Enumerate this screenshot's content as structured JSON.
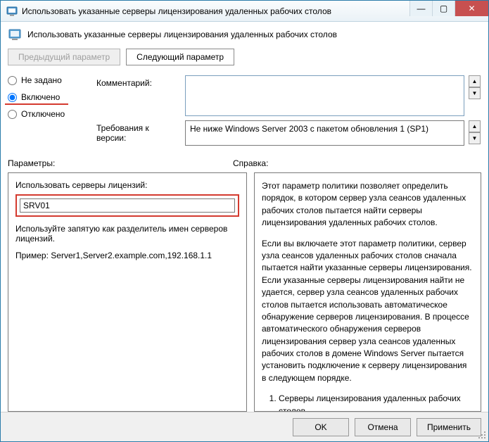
{
  "titlebar": {
    "title": "Использовать указанные серверы лицензирования удаленных рабочих столов"
  },
  "header": {
    "title": "Использовать указанные серверы лицензирования удаленных рабочих столов"
  },
  "nav": {
    "prev": "Предыдущий параметр",
    "next": "Следующий параметр"
  },
  "state": {
    "not_configured": "Не задано",
    "enabled": "Включено",
    "disabled": "Отключено",
    "selected": "enabled"
  },
  "fields": {
    "comment_label": "Комментарий:",
    "comment_value": "",
    "requirements_label": "Требования к версии:",
    "requirements_value": "Не ниже Windows Server 2003 с пакетом обновления 1 (SP1)"
  },
  "sections": {
    "options_label": "Параметры:",
    "help_label": "Справка:"
  },
  "options": {
    "servers_label": "Использовать серверы лицензий:",
    "servers_value": "SRV01",
    "hint": "Используйте запятую как разделитель имен серверов лицензий.",
    "example": "Пример: Server1,Server2.example.com,192.168.1.1"
  },
  "help": {
    "p1": "Этот параметр политики позволяет определить порядок, в котором сервер узла сеансов удаленных рабочих столов пытается найти серверы лицензирования удаленных рабочих столов.",
    "p2": "Если вы включаете этот параметр политики, сервер узла сеансов удаленных рабочих столов сначала пытается найти указанные серверы лицензирования. Если указанные серверы лицензирования найти не удается, сервер узла сеансов удаленных рабочих столов пытается использовать автоматическое обнаружение серверов лицензирования. В процессе автоматического обнаружения серверов лицензирования сервер узла сеансов удаленных рабочих столов в домене Windows Server пытается установить подключение к серверу лицензирования в следующем порядке.",
    "li1": "Серверы лицензирования удаленных рабочих столов,"
  },
  "footer": {
    "ok": "OK",
    "cancel": "Отмена",
    "apply": "Применить"
  }
}
